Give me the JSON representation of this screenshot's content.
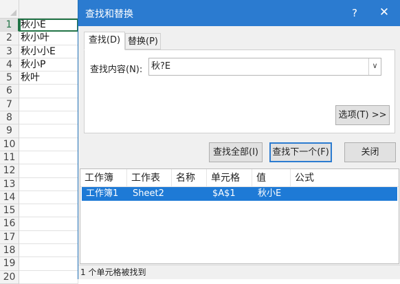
{
  "sheet": {
    "rows": [
      {
        "num": "1",
        "value": "秋小E"
      },
      {
        "num": "2",
        "value": "秋小叶"
      },
      {
        "num": "3",
        "value": "秋小小E"
      },
      {
        "num": "4",
        "value": "秋小P"
      },
      {
        "num": "5",
        "value": "秋叶"
      },
      {
        "num": "6",
        "value": ""
      },
      {
        "num": "7",
        "value": ""
      },
      {
        "num": "8",
        "value": ""
      },
      {
        "num": "9",
        "value": ""
      },
      {
        "num": "10",
        "value": ""
      },
      {
        "num": "11",
        "value": ""
      },
      {
        "num": "12",
        "value": ""
      },
      {
        "num": "13",
        "value": ""
      },
      {
        "num": "14",
        "value": ""
      },
      {
        "num": "15",
        "value": ""
      },
      {
        "num": "16",
        "value": ""
      },
      {
        "num": "17",
        "value": ""
      },
      {
        "num": "18",
        "value": ""
      },
      {
        "num": "19",
        "value": ""
      },
      {
        "num": "20",
        "value": ""
      }
    ],
    "active_row": "1"
  },
  "dialog": {
    "title": "查找和替换",
    "help": "?",
    "close": "✕",
    "tabs": {
      "find": "查找(D)",
      "replace": "替换(P)"
    },
    "find_label": "查找内容(N):",
    "find_value": "秋?E",
    "dropdown_glyph": "∨",
    "buttons": {
      "options": "选项(T) >>",
      "find_all": "查找全部(I)",
      "find_next": "查找下一个(F)",
      "close": "关闭"
    },
    "results": {
      "columns": [
        "工作簿",
        "工作表",
        "名称",
        "单元格",
        "值",
        "公式"
      ],
      "rows": [
        {
          "workbook": "工作簿1",
          "sheet": "Sheet2",
          "name": "",
          "cell": "$A$1",
          "value": "秋小E",
          "formula": ""
        }
      ]
    },
    "status": "1 个单元格被找到"
  }
}
